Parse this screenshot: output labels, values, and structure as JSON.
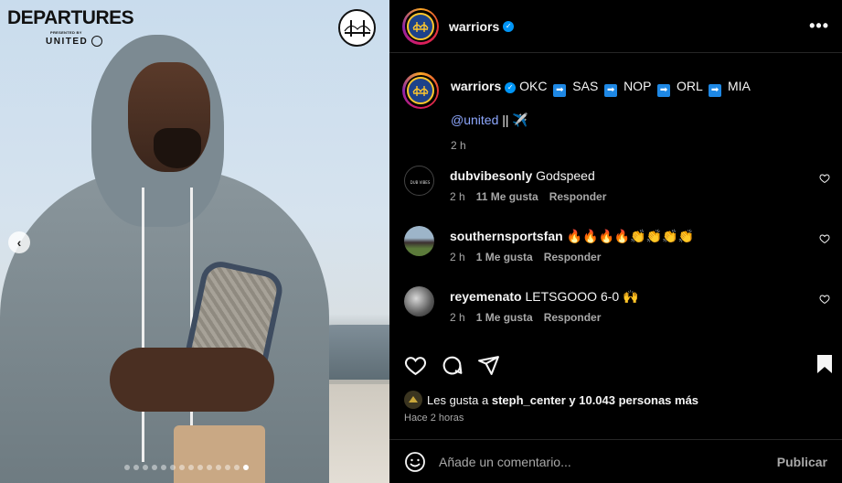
{
  "photo": {
    "title": "DEPARTURES",
    "presented": "PRESENTED BY",
    "sponsor": "UNITED",
    "dots_count": 14,
    "active_dot": 14
  },
  "header": {
    "username": "warriors",
    "more_label": "•••"
  },
  "caption": {
    "username": "warriors",
    "route": [
      "OKC",
      "SAS",
      "NOP",
      "ORL",
      "MIA"
    ],
    "arrow": "➡",
    "mention": "@united",
    "after_mention": "|| ✈️",
    "time": "2 h"
  },
  "comments": [
    {
      "username": "dubvibesonly",
      "text": "Godspeed",
      "time": "2 h",
      "likes": "11 Me gusta",
      "reply": "Responder",
      "avatar_color": "#000000"
    },
    {
      "username": "southernsportsfan",
      "text": "🔥🔥🔥🔥👏👏👏👏",
      "time": "2 h",
      "likes": "1 Me gusta",
      "reply": "Responder",
      "avatar_color": "#5b7a3a"
    },
    {
      "username": "reyemenato",
      "text": "LETSGOOO 6-0 🙌",
      "time": "2 h",
      "likes": "1 Me gusta",
      "reply": "Responder",
      "avatar_color": "#6b6b6b"
    }
  ],
  "likes": {
    "prefix": "Les gusta a",
    "user": "steph_center",
    "suffix": "y 10.043 personas más"
  },
  "posted": "Hace 2 horas",
  "composer": {
    "placeholder": "Añade un comentario...",
    "publish": "Publicar"
  },
  "colors": {
    "background": "#000000",
    "verified": "#0095f6",
    "mention": "#8ea8ff",
    "muted": "#a8a8a8"
  }
}
